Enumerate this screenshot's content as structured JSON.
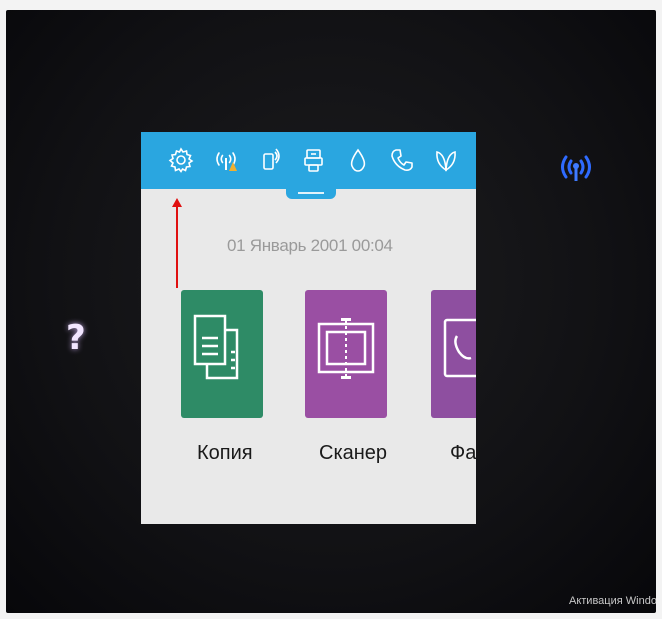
{
  "device": {
    "help_glyph": "?",
    "wifi_led_icon": "wireless-led-icon"
  },
  "status_bar": {
    "icons": [
      "gear-icon",
      "wireless-signal-icon",
      "wifi-direct-icon",
      "web-services-icon",
      "ink-drop-icon",
      "phone-icon",
      "leaf-icon"
    ]
  },
  "home": {
    "datetime": "01 Январь 2001  00:04",
    "tiles": [
      {
        "label": "Копия",
        "color": "#2e8b66",
        "icon": "copy-icon"
      },
      {
        "label": "Сканер",
        "color": "#9a4fa3",
        "icon": "scanner-icon"
      },
      {
        "label": "Фа",
        "color": "#8e4fa0",
        "icon": "fax-icon"
      }
    ]
  },
  "colors": {
    "status_bar": "#2aa6e0",
    "annotation_arrow": "#e01010"
  },
  "overlay": {
    "windows_watermark": "Активация Windo"
  }
}
